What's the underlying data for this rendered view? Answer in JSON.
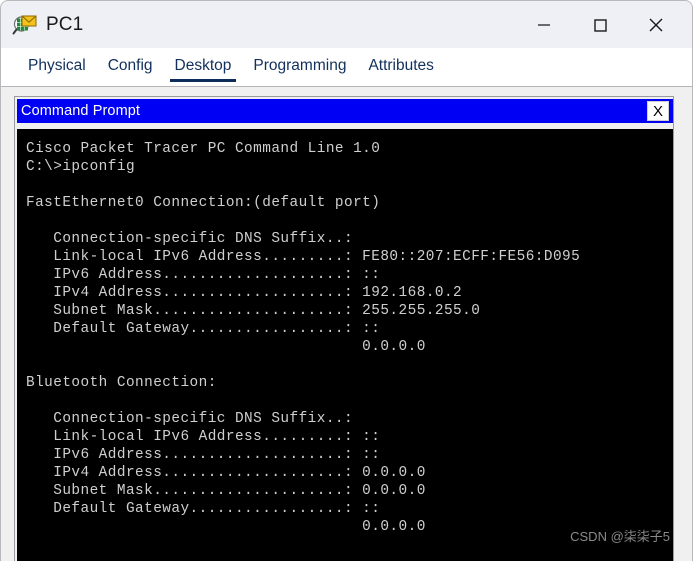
{
  "window": {
    "title": "PC1",
    "icon": "packet-tracer-pc-icon",
    "controls": {
      "minimize_label": "—",
      "maximize_label": "☐",
      "close_label": "✕"
    }
  },
  "tabs": [
    {
      "label": "Physical",
      "active": false
    },
    {
      "label": "Config",
      "active": false
    },
    {
      "label": "Desktop",
      "active": true
    },
    {
      "label": "Programming",
      "active": false
    },
    {
      "label": "Attributes",
      "active": false
    }
  ],
  "cmd_window": {
    "title": "Command Prompt",
    "close_label": "X",
    "titlebar_color": "#0000f4",
    "background_color": "#000000",
    "text_color": "#cfcfcf"
  },
  "terminal": {
    "banner": "Cisco Packet Tracer PC Command Line 1.0",
    "prompt": "C:\\>",
    "command": "ipconfig",
    "adapters": [
      {
        "name": "FastEthernet0 Connection:(default port)",
        "fields": [
          {
            "label": "Connection-specific DNS Suffix..",
            "value": ""
          },
          {
            "label": "Link-local IPv6 Address.........",
            "value": "FE80::207:ECFF:FE56:D095"
          },
          {
            "label": "IPv6 Address....................",
            "value": "::"
          },
          {
            "label": "IPv4 Address....................",
            "value": "192.168.0.2"
          },
          {
            "label": "Subnet Mask.....................",
            "value": "255.255.255.0"
          },
          {
            "label": "Default Gateway.................",
            "value": "::"
          },
          {
            "label": "",
            "value": "0.0.0.0"
          }
        ]
      },
      {
        "name": "Bluetooth Connection:",
        "fields": [
          {
            "label": "Connection-specific DNS Suffix..",
            "value": ""
          },
          {
            "label": "Link-local IPv6 Address.........",
            "value": "::"
          },
          {
            "label": "IPv6 Address....................",
            "value": "::"
          },
          {
            "label": "IPv4 Address....................",
            "value": "0.0.0.0"
          },
          {
            "label": "Subnet Mask.....................",
            "value": "0.0.0.0"
          },
          {
            "label": "Default Gateway.................",
            "value": "::"
          },
          {
            "label": "",
            "value": "0.0.0.0"
          }
        ]
      }
    ],
    "full_text": "Cisco Packet Tracer PC Command Line 1.0\nC:\\>ipconfig\n\nFastEthernet0 Connection:(default port)\n\n   Connection-specific DNS Suffix..:\n   Link-local IPv6 Address.........: FE80::207:ECFF:FE56:D095\n   IPv6 Address....................: ::\n   IPv4 Address....................: 192.168.0.2\n   Subnet Mask.....................: 255.255.255.0\n   Default Gateway.................: ::\n                                     0.0.0.0\n\nBluetooth Connection:\n\n   Connection-specific DNS Suffix..:\n   Link-local IPv6 Address.........: ::\n   IPv6 Address....................: ::\n   IPv4 Address....................: 0.0.0.0\n   Subnet Mask.....................: 0.0.0.0\n   Default Gateway.................: ::\n                                     0.0.0.0"
  },
  "watermark": {
    "text": "CSDN @柒柒子5"
  }
}
